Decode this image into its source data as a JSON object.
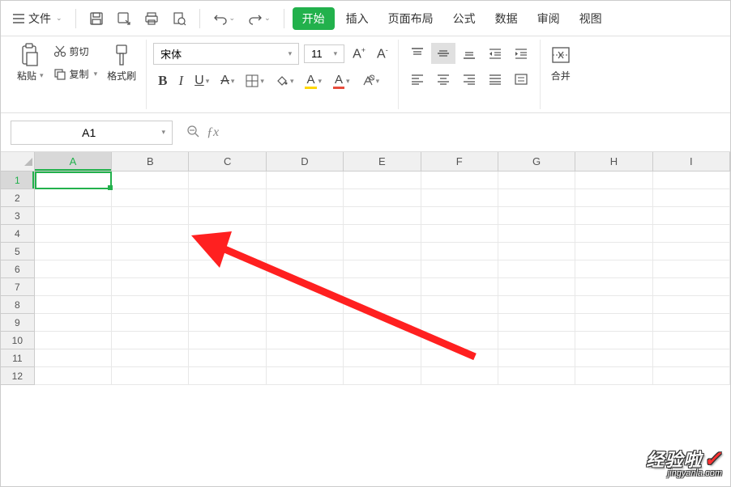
{
  "menubar": {
    "file_label": "文件",
    "tabs": {
      "start": "开始",
      "insert": "插入",
      "page_layout": "页面布局",
      "formulas": "公式",
      "data": "数据",
      "review": "审阅",
      "view": "视图"
    }
  },
  "ribbon": {
    "paste_label": "粘贴",
    "cut_label": "剪切",
    "copy_label": "复制",
    "format_painter_label": "格式刷",
    "font_name": "宋体",
    "font_size": "11",
    "merge_label": "合并"
  },
  "formula_bar": {
    "name_box": "A1"
  },
  "sheet": {
    "columns": [
      "A",
      "B",
      "C",
      "D",
      "E",
      "F",
      "G",
      "H",
      "I"
    ],
    "active_col": "A",
    "rows": [
      "1",
      "2",
      "3",
      "4",
      "5",
      "6",
      "7",
      "8",
      "9",
      "10",
      "11",
      "12"
    ],
    "active_row": "1"
  },
  "watermark": {
    "main": "经验啦",
    "sub": "jingyanla.com"
  }
}
